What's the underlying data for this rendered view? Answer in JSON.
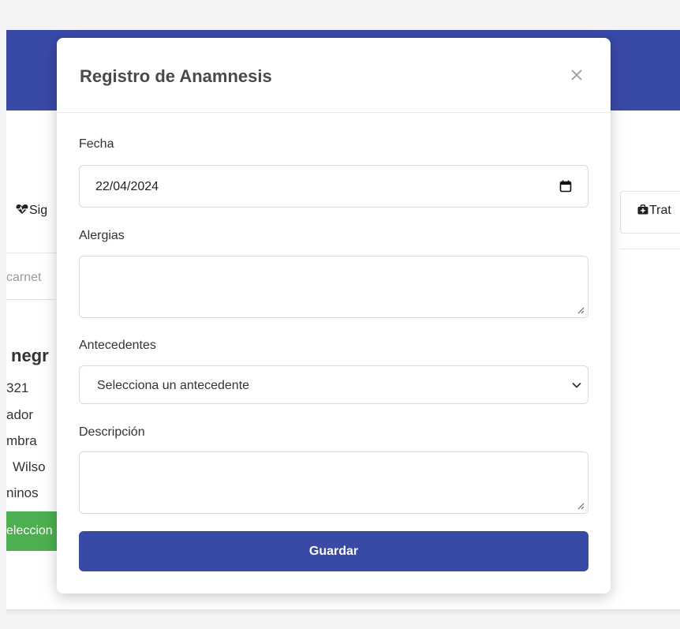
{
  "background": {
    "tab_left_label": "Sig",
    "tab_right_label": "Trat",
    "search_placeholder": "carnet",
    "patient_name": "negr",
    "info_lines": [
      "321",
      "ador",
      "mbra",
      "Wilso",
      "ninos"
    ],
    "select_button_label": "eleccion",
    "colors": {
      "header": "#3949a6",
      "select_button": "#4caf50"
    }
  },
  "modal": {
    "title": "Registro de Anamnesis",
    "close_icon": "close-icon",
    "fields": {
      "fecha": {
        "label": "Fecha",
        "value": "22/04/2024",
        "icon": "calendar-icon"
      },
      "alergias": {
        "label": "Alergias",
        "value": ""
      },
      "antecedentes": {
        "label": "Antecedentes",
        "selected": "Selecciona un antecedente",
        "icon": "chevron-down-icon"
      },
      "descripcion": {
        "label": "Descripción",
        "value": ""
      }
    },
    "save_label": "Guardar",
    "colors": {
      "primary": "#3949a6"
    }
  }
}
